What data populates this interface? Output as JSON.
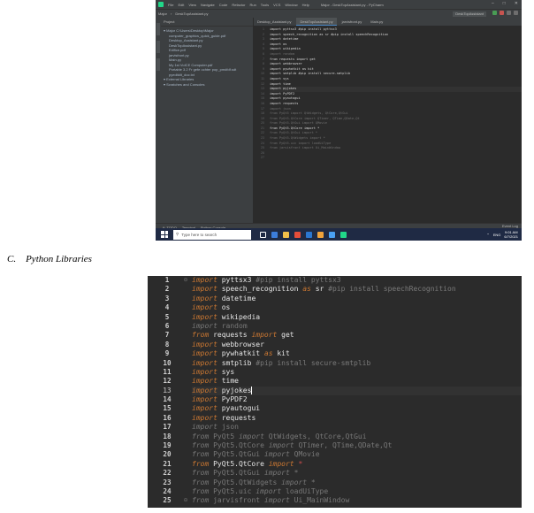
{
  "ide": {
    "menu": [
      "File",
      "Edit",
      "View",
      "Navigate",
      "Code",
      "Refactor",
      "Run",
      "Tools",
      "VCS",
      "Window",
      "Help"
    ],
    "window_title": "Major - DeskTopAssistant.py - PyCharm",
    "breadcrumb": [
      "Major",
      "DeskTopAssistant.py"
    ],
    "run_config": "DeskTopAssistant",
    "project_header": "Project",
    "tree": [
      {
        "label": "Major  C:\\Users\\Desktop\\Major",
        "depth": 0
      },
      {
        "label": "computer_graphics_quick_guide.pdf",
        "depth": 1
      },
      {
        "label": "Desktop_Assistant.py",
        "depth": 1
      },
      {
        "label": "DeskTopAssistant.py",
        "depth": 1
      },
      {
        "label": "Edifice.pdf",
        "depth": 1
      },
      {
        "label": "jarvisfront.py",
        "depth": 1
      },
      {
        "label": "Main.py",
        "depth": 1
      },
      {
        "label": "My 1st VoICE Computer.pdf",
        "depth": 1
      },
      {
        "label": "Portable 3.2 Fr gefe ochter pop_pmdfdf.sdt",
        "depth": 1
      },
      {
        "label": "pyeditdit_doc.txt",
        "depth": 1
      },
      {
        "label": "External Libraries",
        "depth": 0
      },
      {
        "label": "Scratches and Consoles",
        "depth": 0
      }
    ],
    "tabs": [
      "Desktop_Assistant.py",
      "DeskTopAssistant.py",
      "jarvisfront.py",
      "Main.py"
    ],
    "active_tab": 1,
    "gutter": [
      "1",
      "2",
      "3",
      "4",
      "5",
      "6",
      "7",
      "8",
      "9",
      "10",
      "11",
      "12",
      "13",
      "14",
      "15",
      "16",
      "17",
      "18",
      "19",
      "20",
      "21",
      "22",
      "23",
      "24",
      "25",
      "26",
      "27"
    ],
    "code": [
      "import pyttsx3 #pip install pyttsx3",
      "import speech_recognition as sr #pip install speechRecognition",
      "import datetime",
      "import os",
      "import wikipedia",
      "import random",
      "from requests import get",
      "import webbrowser",
      "import pywhatkit as kit",
      "import smtplib #pip install secure-smtplib",
      "import sys",
      "import time",
      "import pyjokes",
      "import PyPDF2",
      "import pyautogui",
      "import requests",
      "import json",
      "from PyQt5 import QtWidgets, QtCore,QtGui",
      "from PyQt5.QtCore import QTimer, QTime,QDate,Qt",
      "from PyQt5.QtGui import QMovie",
      "from PyQt5.QtCore import *",
      "from PyQt5.QtGui import *",
      "from PyQt5.QtWidgets import *",
      "from PyQt5.uic import loadUiType",
      "from jarvisfront import Ui_MainWindow",
      "",
      ""
    ],
    "bottom_tools": [
      "6: TODO",
      "Terminal",
      "Python Console"
    ],
    "event_log": "Event Log",
    "status": "13:21  CRLF  UTF-8  4 spaces  Python 3.8"
  },
  "taskbar": {
    "search_placeholder": "Type here to search",
    "time": "9:01 AM",
    "date": "6/7/2021",
    "lang": "ENG"
  },
  "caption": "C.    Python Libraries",
  "zoom": {
    "line_numbers": [
      "1",
      "2",
      "3",
      "4",
      "5",
      "6",
      "7",
      "8",
      "9",
      "10",
      "11",
      "12",
      "13",
      "14",
      "15",
      "16",
      "17",
      "18",
      "19",
      "20",
      "21",
      "22",
      "23",
      "24",
      "25"
    ],
    "current_line": 13
  }
}
